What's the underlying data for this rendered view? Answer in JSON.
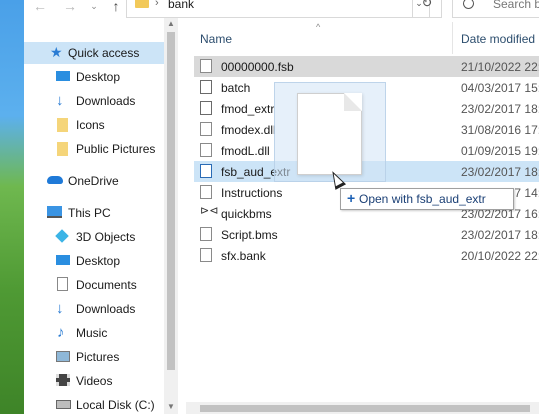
{
  "address": {
    "path": "bank"
  },
  "search": {
    "placeholder": "Search b"
  },
  "sidebar": {
    "items": [
      {
        "label": "Quick access",
        "icon": "star-icon"
      },
      {
        "label": "Desktop",
        "icon": "desktop-icon"
      },
      {
        "label": "Downloads",
        "icon": "download-icon"
      },
      {
        "label": "Icons",
        "icon": "folder-icon"
      },
      {
        "label": "Public Pictures",
        "icon": "folder-icon"
      },
      {
        "label": "OneDrive",
        "icon": "cloud-icon"
      },
      {
        "label": "This PC",
        "icon": "pc-icon"
      },
      {
        "label": "3D Objects",
        "icon": "cube-icon"
      },
      {
        "label": "Desktop",
        "icon": "desktop-icon"
      },
      {
        "label": "Documents",
        "icon": "documents-icon"
      },
      {
        "label": "Downloads",
        "icon": "download-icon"
      },
      {
        "label": "Music",
        "icon": "music-icon"
      },
      {
        "label": "Pictures",
        "icon": "pictures-icon"
      },
      {
        "label": "Videos",
        "icon": "videos-icon"
      },
      {
        "label": "Local Disk (C:)",
        "icon": "disk-icon"
      }
    ]
  },
  "columns": {
    "name": "Name",
    "date": "Date modified"
  },
  "files": [
    {
      "name": "00000000.fsb",
      "date": "21/10/2022 22:"
    },
    {
      "name": "batch",
      "date": "04/03/2017 15:"
    },
    {
      "name": "fmod_extr",
      "date": "23/02/2017 18:"
    },
    {
      "name": "fmodex.dll",
      "date": "31/08/2016 17:"
    },
    {
      "name": "fmodL.dll",
      "date": "01/09/2015 19:"
    },
    {
      "name": "fsb_aud_extr",
      "date": "23/02/2017 18:"
    },
    {
      "name": "Instructions",
      "date": "23/02/2017 14:"
    },
    {
      "name": "quickbms",
      "date": "23/02/2017 16:"
    },
    {
      "name": "Script.bms",
      "date": "23/02/2017 18:"
    },
    {
      "name": "sfx.bank",
      "date": "20/10/2022 22:"
    }
  ],
  "drag": {
    "tooltip": "Open with fsb_aud_extr"
  },
  "colors": {
    "selected": "#cce4f7",
    "accent": "#1a5fb4",
    "folder": "#f2c95a"
  }
}
